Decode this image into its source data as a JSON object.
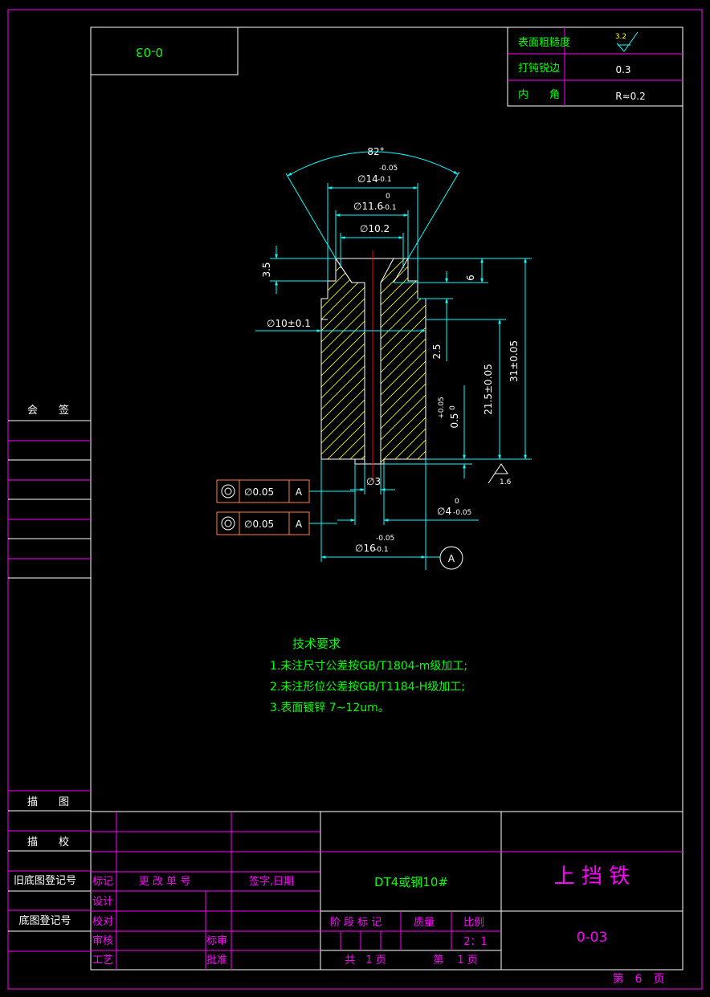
{
  "drawing": {
    "code_top_left": "0-03",
    "roughness_label": "表面粗糙度",
    "roughness_value": "3.2",
    "deburr_label": "打钝锐边",
    "deburr_value": "0.3",
    "inner_corner_label": "内　　角",
    "inner_corner_value": "R≈0.2",
    "angle": "82°",
    "dim_d14": "∅14",
    "tol_d14_upper": "-0.05",
    "tol_d14_lower": "-0.1",
    "dim_d11": "∅11.6",
    "tol_d11_upper": "0",
    "tol_d11_lower": "-0.1",
    "dim_d10_2": "∅10.2",
    "dim_3_5": "3.5",
    "dim_6": "6",
    "dim_d10": "∅10±0.1",
    "dim_2_5": "2.5",
    "dim_21_5": "21.5±0.05",
    "dim_31": "31±0.05",
    "dim_0_5": "0.5",
    "tol_0_5_upper": "+0.05",
    "tol_0_5_lower": "0",
    "roughness_bottom": "1.6",
    "dim_d3": "∅3",
    "dim_d4": "∅4",
    "tol_d4_upper": "0",
    "tol_d4_lower": "-0.05",
    "dim_d16": "∅16",
    "tol_d16_upper": "-0.05",
    "tol_d16_lower": "-0.1",
    "datum": "A",
    "fcf": [
      {
        "value": "∅0.05",
        "datum": "A"
      },
      {
        "value": "∅0.05",
        "datum": "A"
      }
    ]
  },
  "notes": {
    "title": "技术要求",
    "items": [
      "1.未注尺寸公差按GB/T1804-m级加工;",
      "2.未注形位公差按GB/T1184-H级加工;",
      "3.表面镀锌 7~12um。"
    ]
  },
  "left_column": {
    "countersign": "会　　签",
    "drawn": "描　　图",
    "checked": "描　　校",
    "old_reg": "旧底图登记号",
    "reg": "底图登记号"
  },
  "title_block": {
    "mark": "标记",
    "change_no": "更 改 单 号",
    "sign_date": "签字,日期",
    "design": "设计",
    "proofread": "校对",
    "review": "审核",
    "standard": "标审",
    "process": "工艺",
    "approve": "批准",
    "material": "DT4或钢10#",
    "stage_mark": "阶 段 标 记",
    "mass": "质量",
    "scale_label": "比例",
    "scale": "2：1",
    "total_pages": "共　1 页",
    "page_no": "第　 1 页",
    "part_name": "上 挡 铁",
    "part_code": "0-03"
  },
  "sheet_no": "第　6　页",
  "colors": {
    "frame": "#ff00ff",
    "border": "#ffffff",
    "dim": "#00ffff",
    "text": "#00ff00",
    "hatch": "#ffff00",
    "center": "#ff0000",
    "fcf": "#ff8040"
  }
}
